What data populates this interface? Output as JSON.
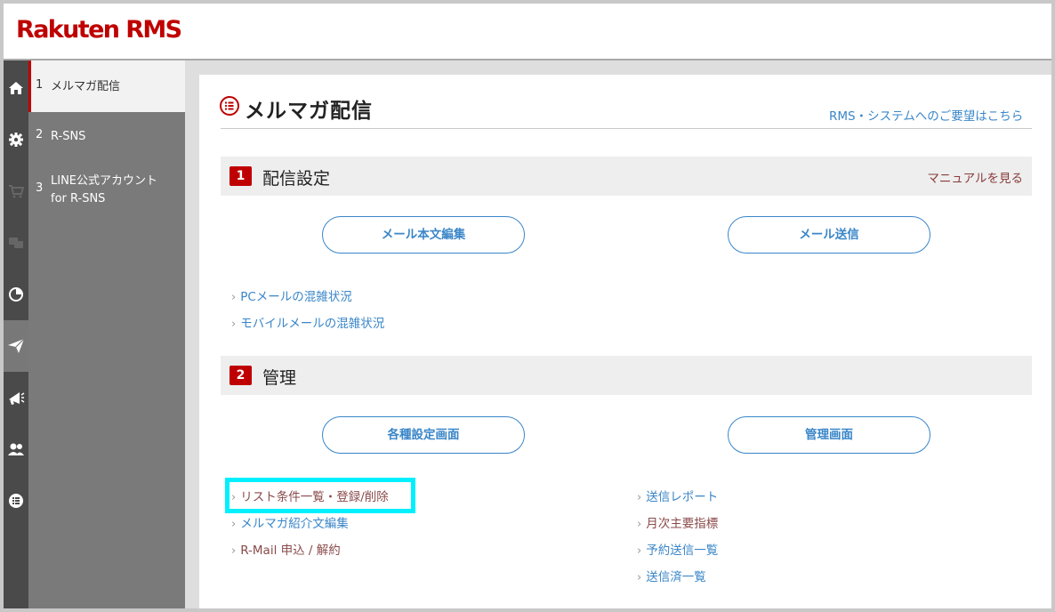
{
  "header": {
    "logo": "Rakuten RMS"
  },
  "rail": {
    "items": [
      {
        "icon": "home-icon"
      },
      {
        "icon": "gear-icon"
      },
      {
        "icon": "cart-icon"
      },
      {
        "icon": "chat-icon"
      },
      {
        "icon": "pie-chart-icon"
      },
      {
        "icon": "send-icon",
        "active": true
      },
      {
        "icon": "megaphone-icon"
      },
      {
        "icon": "users-icon"
      },
      {
        "icon": "list-icon"
      }
    ]
  },
  "sidebar": {
    "items": [
      {
        "num": "1",
        "label": "メルマガ配信"
      },
      {
        "num": "2",
        "label": "R-SNS"
      },
      {
        "num": "3",
        "label_line1": "LINE公式アカウント",
        "label_line2": "for R-SNS"
      }
    ]
  },
  "main": {
    "title": "メルマガ配信",
    "request_link": "RMS・システムへのご要望はこちら",
    "sections": [
      {
        "num": "1",
        "title": "配信設定",
        "manual_link": "マニュアルを見る",
        "buttons": [
          "メール本文編集",
          "メール送信"
        ],
        "links": [
          "PCメールの混雑状況",
          "モバイルメールの混雑状況"
        ]
      },
      {
        "num": "2",
        "title": "管理",
        "buttons": [
          "各種設定画面",
          "管理画面"
        ],
        "links_left": [
          "リスト条件一覧・登録/削除",
          "メルマガ紹介文編集",
          "R-Mail 申込 / 解約"
        ],
        "links_right": [
          "送信レポート",
          "月次主要指標",
          "予約送信一覧",
          "送信済一覧"
        ]
      }
    ]
  },
  "colors": {
    "brand": "#bf0000",
    "link": "#3a86c8",
    "highlight": "#00f0ff"
  }
}
